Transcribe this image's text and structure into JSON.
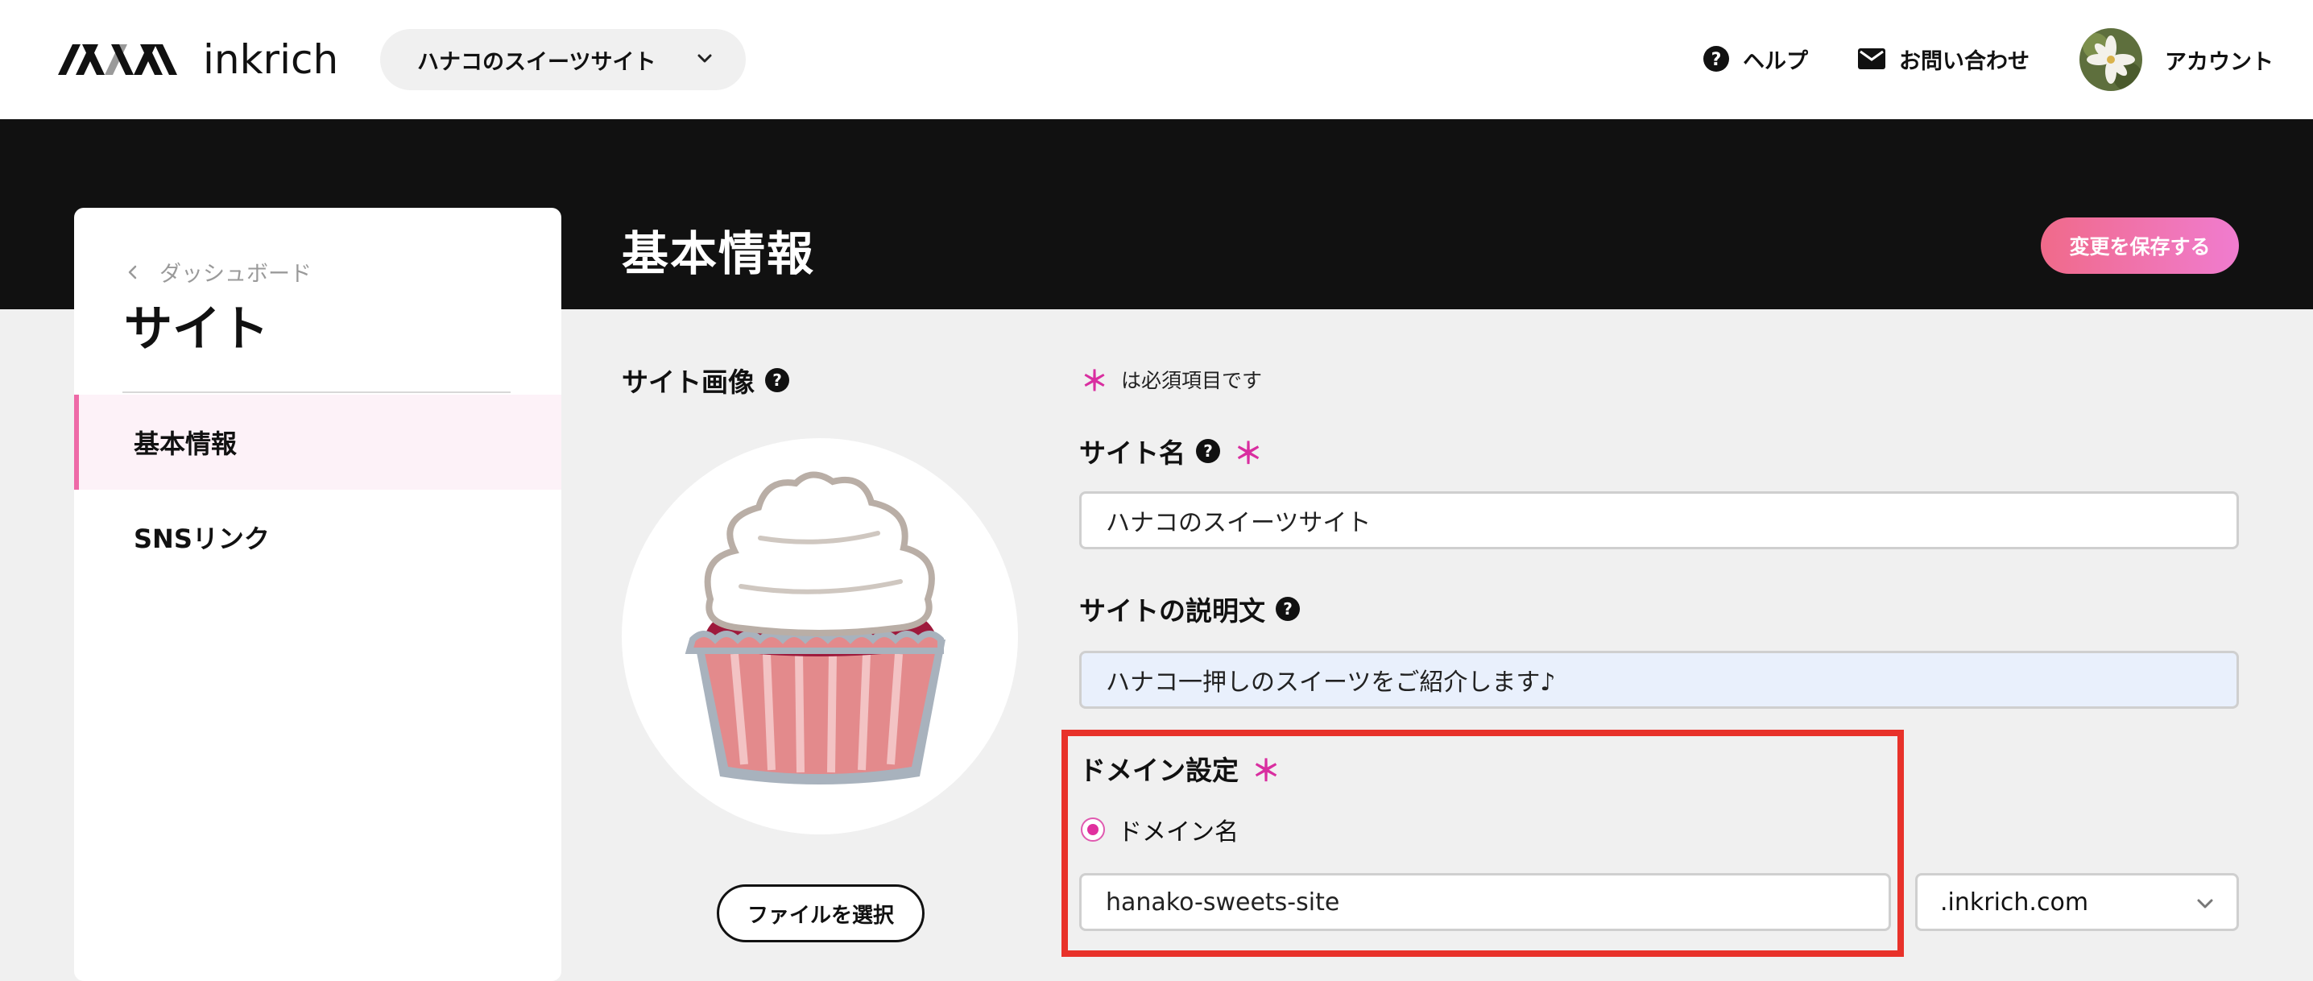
{
  "header": {
    "brand": "inkrich",
    "site_selector": "ハナコのスイーツサイト",
    "help": "ヘルプ",
    "contact": "お問い合わせ",
    "account": "アカウント"
  },
  "page": {
    "title": "基本情報",
    "save_button": "変更を保存する"
  },
  "sidebar": {
    "breadcrumb": "ダッシュボード",
    "title": "サイト",
    "items": [
      {
        "label": "基本情報",
        "active": true
      },
      {
        "label": "SNSリンク",
        "active": false
      }
    ]
  },
  "site_image": {
    "label": "サイト画像",
    "file_button": "ファイルを選択"
  },
  "form": {
    "required_note": "は必須項目です",
    "required_mark": "＊",
    "site_name": {
      "label": "サイト名",
      "value": "ハナコのスイーツサイト"
    },
    "site_description": {
      "label": "サイトの説明文",
      "value": "ハナコ一押しのスイーツをご紹介します♪"
    },
    "domain": {
      "label": "ドメイン設定",
      "radio_label": "ドメイン名",
      "value": "hanako-sweets-site",
      "suffix": ".inkrich.com"
    }
  },
  "colors": {
    "accent_pink": "#e0309e",
    "save_gradient_start": "#f06a8a",
    "save_gradient_end": "#f07ccf",
    "highlight_red": "#e8322a",
    "band": "#111111"
  },
  "icons": [
    "logo-mark-icon",
    "chevron-down-icon",
    "help-icon",
    "mail-icon",
    "avatar",
    "chevron-left-icon",
    "question-icon"
  ]
}
